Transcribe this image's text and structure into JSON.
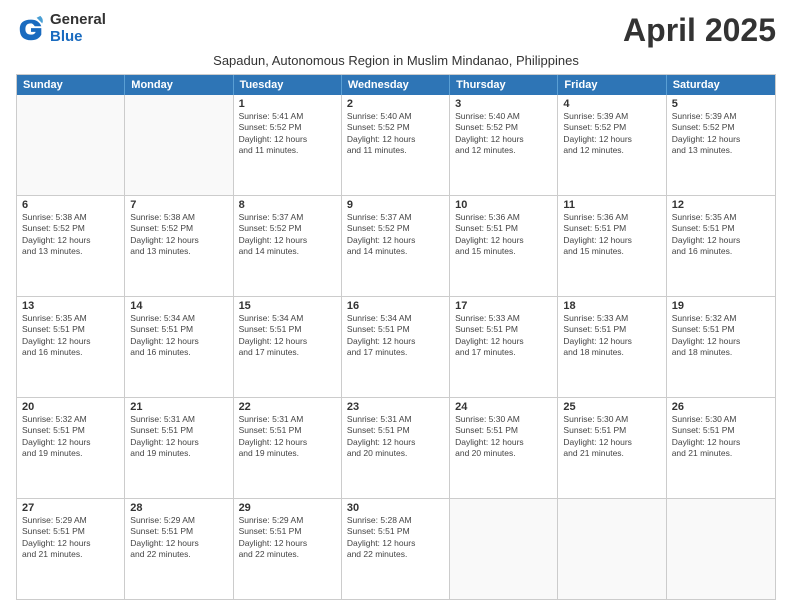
{
  "logo": {
    "general": "General",
    "blue": "Blue"
  },
  "title": "April 2025",
  "subtitle": "Sapadun, Autonomous Region in Muslim Mindanao, Philippines",
  "header_days": [
    "Sunday",
    "Monday",
    "Tuesday",
    "Wednesday",
    "Thursday",
    "Friday",
    "Saturday"
  ],
  "weeks": [
    [
      {
        "day": "",
        "info": ""
      },
      {
        "day": "",
        "info": ""
      },
      {
        "day": "1",
        "info": "Sunrise: 5:41 AM\nSunset: 5:52 PM\nDaylight: 12 hours\nand 11 minutes."
      },
      {
        "day": "2",
        "info": "Sunrise: 5:40 AM\nSunset: 5:52 PM\nDaylight: 12 hours\nand 11 minutes."
      },
      {
        "day": "3",
        "info": "Sunrise: 5:40 AM\nSunset: 5:52 PM\nDaylight: 12 hours\nand 12 minutes."
      },
      {
        "day": "4",
        "info": "Sunrise: 5:39 AM\nSunset: 5:52 PM\nDaylight: 12 hours\nand 12 minutes."
      },
      {
        "day": "5",
        "info": "Sunrise: 5:39 AM\nSunset: 5:52 PM\nDaylight: 12 hours\nand 13 minutes."
      }
    ],
    [
      {
        "day": "6",
        "info": "Sunrise: 5:38 AM\nSunset: 5:52 PM\nDaylight: 12 hours\nand 13 minutes."
      },
      {
        "day": "7",
        "info": "Sunrise: 5:38 AM\nSunset: 5:52 PM\nDaylight: 12 hours\nand 13 minutes."
      },
      {
        "day": "8",
        "info": "Sunrise: 5:37 AM\nSunset: 5:52 PM\nDaylight: 12 hours\nand 14 minutes."
      },
      {
        "day": "9",
        "info": "Sunrise: 5:37 AM\nSunset: 5:52 PM\nDaylight: 12 hours\nand 14 minutes."
      },
      {
        "day": "10",
        "info": "Sunrise: 5:36 AM\nSunset: 5:51 PM\nDaylight: 12 hours\nand 15 minutes."
      },
      {
        "day": "11",
        "info": "Sunrise: 5:36 AM\nSunset: 5:51 PM\nDaylight: 12 hours\nand 15 minutes."
      },
      {
        "day": "12",
        "info": "Sunrise: 5:35 AM\nSunset: 5:51 PM\nDaylight: 12 hours\nand 16 minutes."
      }
    ],
    [
      {
        "day": "13",
        "info": "Sunrise: 5:35 AM\nSunset: 5:51 PM\nDaylight: 12 hours\nand 16 minutes."
      },
      {
        "day": "14",
        "info": "Sunrise: 5:34 AM\nSunset: 5:51 PM\nDaylight: 12 hours\nand 16 minutes."
      },
      {
        "day": "15",
        "info": "Sunrise: 5:34 AM\nSunset: 5:51 PM\nDaylight: 12 hours\nand 17 minutes."
      },
      {
        "day": "16",
        "info": "Sunrise: 5:34 AM\nSunset: 5:51 PM\nDaylight: 12 hours\nand 17 minutes."
      },
      {
        "day": "17",
        "info": "Sunrise: 5:33 AM\nSunset: 5:51 PM\nDaylight: 12 hours\nand 17 minutes."
      },
      {
        "day": "18",
        "info": "Sunrise: 5:33 AM\nSunset: 5:51 PM\nDaylight: 12 hours\nand 18 minutes."
      },
      {
        "day": "19",
        "info": "Sunrise: 5:32 AM\nSunset: 5:51 PM\nDaylight: 12 hours\nand 18 minutes."
      }
    ],
    [
      {
        "day": "20",
        "info": "Sunrise: 5:32 AM\nSunset: 5:51 PM\nDaylight: 12 hours\nand 19 minutes."
      },
      {
        "day": "21",
        "info": "Sunrise: 5:31 AM\nSunset: 5:51 PM\nDaylight: 12 hours\nand 19 minutes."
      },
      {
        "day": "22",
        "info": "Sunrise: 5:31 AM\nSunset: 5:51 PM\nDaylight: 12 hours\nand 19 minutes."
      },
      {
        "day": "23",
        "info": "Sunrise: 5:31 AM\nSunset: 5:51 PM\nDaylight: 12 hours\nand 20 minutes."
      },
      {
        "day": "24",
        "info": "Sunrise: 5:30 AM\nSunset: 5:51 PM\nDaylight: 12 hours\nand 20 minutes."
      },
      {
        "day": "25",
        "info": "Sunrise: 5:30 AM\nSunset: 5:51 PM\nDaylight: 12 hours\nand 21 minutes."
      },
      {
        "day": "26",
        "info": "Sunrise: 5:30 AM\nSunset: 5:51 PM\nDaylight: 12 hours\nand 21 minutes."
      }
    ],
    [
      {
        "day": "27",
        "info": "Sunrise: 5:29 AM\nSunset: 5:51 PM\nDaylight: 12 hours\nand 21 minutes."
      },
      {
        "day": "28",
        "info": "Sunrise: 5:29 AM\nSunset: 5:51 PM\nDaylight: 12 hours\nand 22 minutes."
      },
      {
        "day": "29",
        "info": "Sunrise: 5:29 AM\nSunset: 5:51 PM\nDaylight: 12 hours\nand 22 minutes."
      },
      {
        "day": "30",
        "info": "Sunrise: 5:28 AM\nSunset: 5:51 PM\nDaylight: 12 hours\nand 22 minutes."
      },
      {
        "day": "",
        "info": ""
      },
      {
        "day": "",
        "info": ""
      },
      {
        "day": "",
        "info": ""
      }
    ]
  ]
}
